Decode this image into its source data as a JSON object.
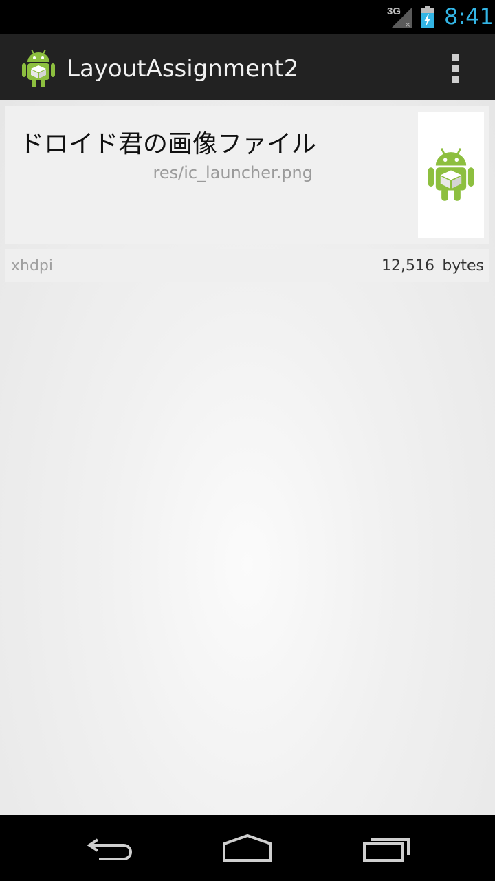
{
  "status_bar": {
    "network": "3G",
    "time": "8:41",
    "icons": [
      "signal-icon",
      "battery-charging-icon"
    ]
  },
  "action_bar": {
    "title": "LayoutAssignment2",
    "icons": [
      "android-launcher-icon",
      "overflow-menu-icon"
    ]
  },
  "card": {
    "title": "ドロイド君の画像ファイル",
    "path": "res/ic_launcher.png",
    "image_icon": "android-launcher-icon"
  },
  "info": {
    "density": "xhdpi",
    "size": "12,516",
    "unit": "bytes"
  },
  "nav_bar": {
    "icons": [
      "back-icon",
      "home-icon",
      "recents-icon"
    ]
  },
  "colors": {
    "clock": "#33b5e5",
    "action_bar": "#222222",
    "android_green": "#8dbf3f"
  }
}
